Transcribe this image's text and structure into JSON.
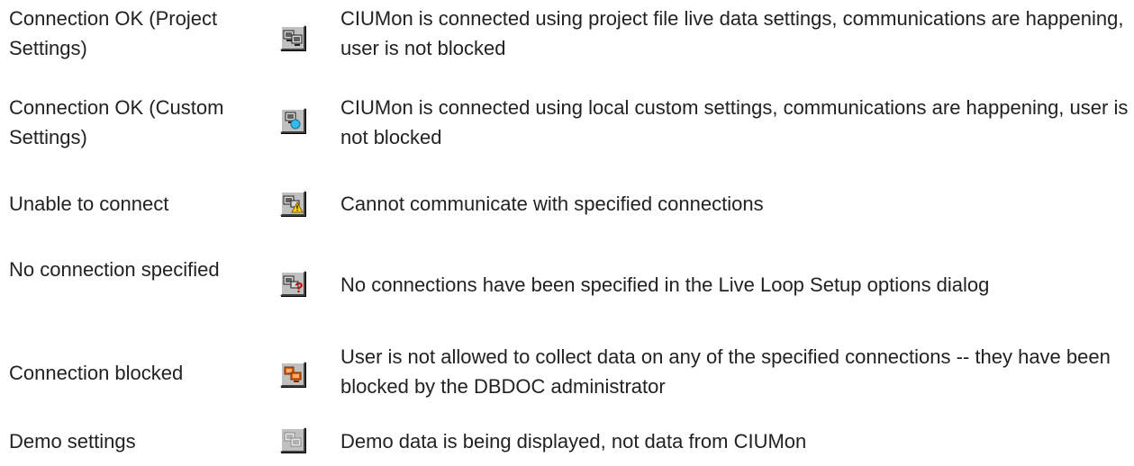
{
  "rows": [
    {
      "label": "Connection OK (Project Settings)",
      "description": "CIUMon is connected using project file live data settings, communications are happening, user is not blocked",
      "icon": "connection-ok-project-icon"
    },
    {
      "label": "Connection OK (Custom Settings)",
      "description": "CIUMon is connected using local custom settings, communications are happening, user is not blocked",
      "icon": "connection-ok-custom-icon"
    },
    {
      "label": "Unable to connect",
      "description": "Cannot communicate with specified connections",
      "icon": "unable-to-connect-icon"
    },
    {
      "label": "No connection specified",
      "description": "No connections have been specified in the Live Loop Setup options dialog",
      "icon": "no-connection-icon"
    },
    {
      "label": "Connection blocked",
      "description": "User is not allowed to collect data on any of the specified connections -- they have been blocked by the DBDOC administrator",
      "icon": "connection-blocked-icon"
    },
    {
      "label": "Demo settings",
      "description": "Demo data is being displayed, not data from CIUMon",
      "icon": "demo-settings-icon"
    }
  ],
  "colors": {
    "text": "#222222",
    "button_face": "#c0c0c0",
    "warning": "#ffd000",
    "error": "#cc0000",
    "blocked": "#e05a00",
    "custom": "#33bbee"
  }
}
